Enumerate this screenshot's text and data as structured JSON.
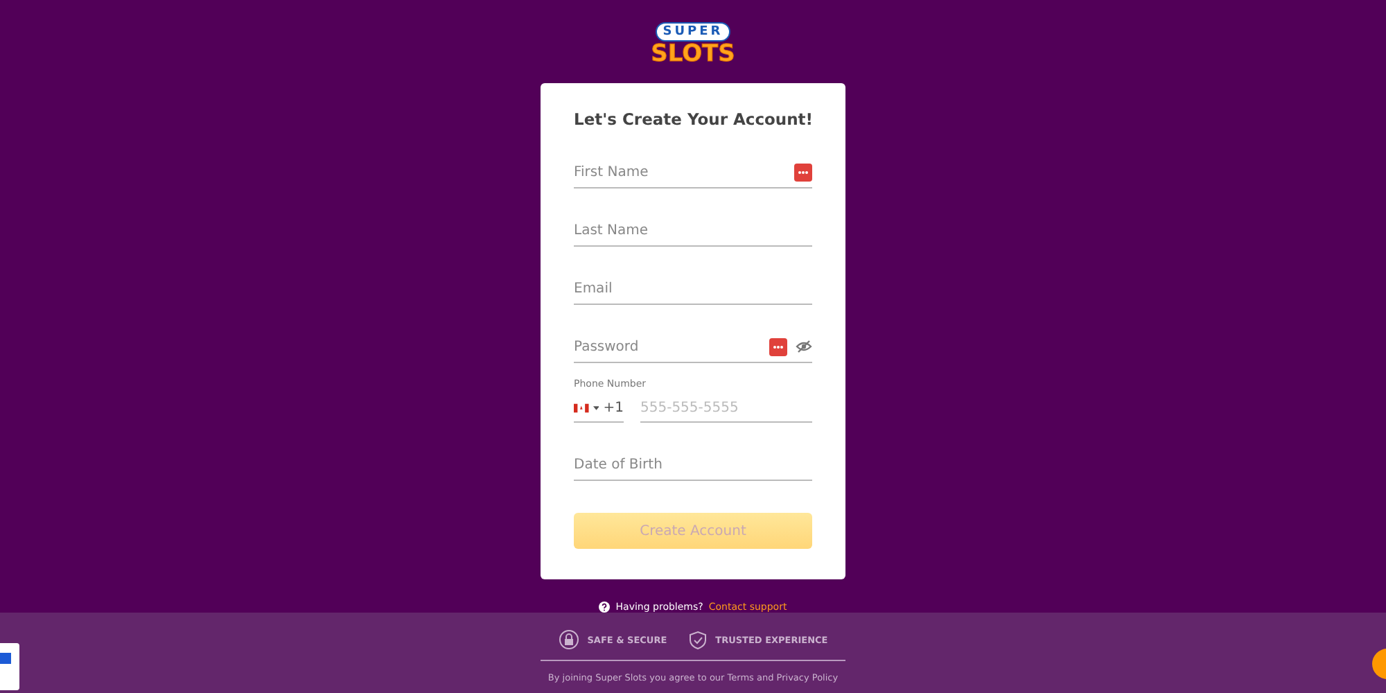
{
  "logo": {
    "top": "SUPER",
    "bottom": "SLOTS"
  },
  "form": {
    "title": "Let's Create Your Account!",
    "fields": [
      {
        "kind": "autofill",
        "placeholder": "First Name"
      },
      {
        "kind": "plain",
        "placeholder": "Last Name"
      },
      {
        "kind": "plain",
        "placeholder": "Email"
      },
      {
        "kind": "password",
        "placeholder": "Password"
      },
      {
        "kind": "phone",
        "label": "Phone Number",
        "code": "+1",
        "placeholder": "555-555-5555"
      },
      {
        "kind": "plain",
        "placeholder": "Date of Birth"
      }
    ],
    "submit": {
      "label": "Create Account",
      "disabled": true
    }
  },
  "help": {
    "text": "Having problems?",
    "link": "Contact support"
  },
  "footer": {
    "badges": [
      {
        "kind": "lock",
        "label": "SAFE & SECURE"
      },
      {
        "kind": "shield",
        "label": "TRUSTED EXPERIENCE"
      }
    ],
    "legal": "By joining Super Slots you agree to our Terms and Privacy Policy"
  }
}
